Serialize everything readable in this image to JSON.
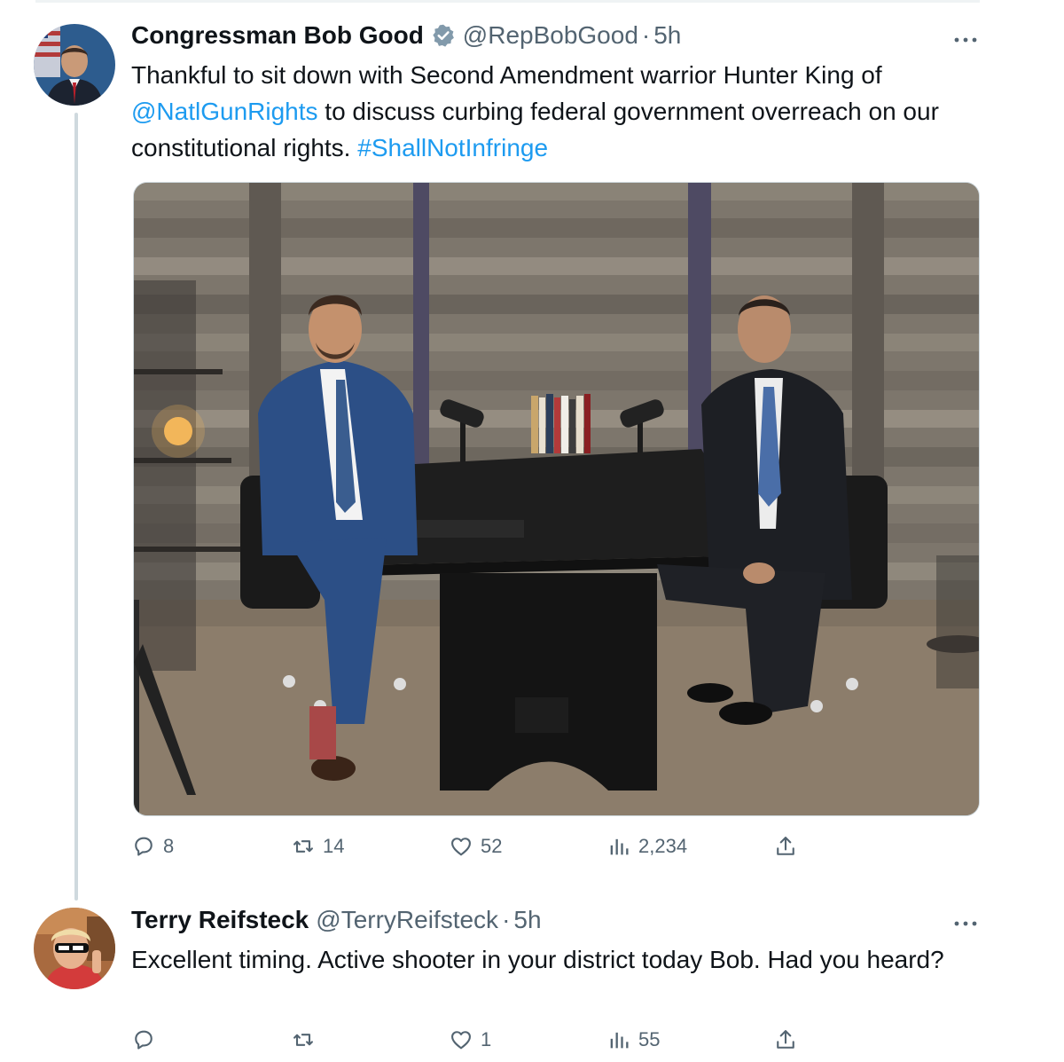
{
  "tweet": {
    "author": {
      "name": "Congressman Bob Good",
      "handle": "@RepBobGood",
      "separator": "·",
      "age": "5h",
      "verified": true
    },
    "text_parts": {
      "t1": "Thankful to sit down with Second Amendment warrior Hunter King of ",
      "mention": "@NatlGunRights",
      "t2": " to discuss curbing federal government overreach on our constitutional rights. ",
      "hashtag": "#ShallNotInfringe"
    },
    "actions": {
      "replies": "8",
      "reposts": "14",
      "likes": "52",
      "views": "2,234"
    }
  },
  "reply": {
    "author": {
      "name": "Terry Reifsteck",
      "handle": "@TerryReifsteck",
      "separator": "·",
      "age": "5h"
    },
    "text": "Excellent timing. Active shooter in your district today Bob. Had you heard?",
    "actions": {
      "replies": "",
      "reposts": "",
      "likes": "1",
      "views": "55"
    }
  },
  "colors": {
    "accent": "#1d9bf0",
    "secondary_text": "#536471",
    "primary_text": "#0f1419"
  },
  "icons": {
    "reply": "reply-icon",
    "repost": "repost-icon",
    "like": "heart-icon",
    "views": "views-chart-icon",
    "share": "share-icon",
    "more": "more-icon",
    "verified": "verified-badge-icon"
  }
}
